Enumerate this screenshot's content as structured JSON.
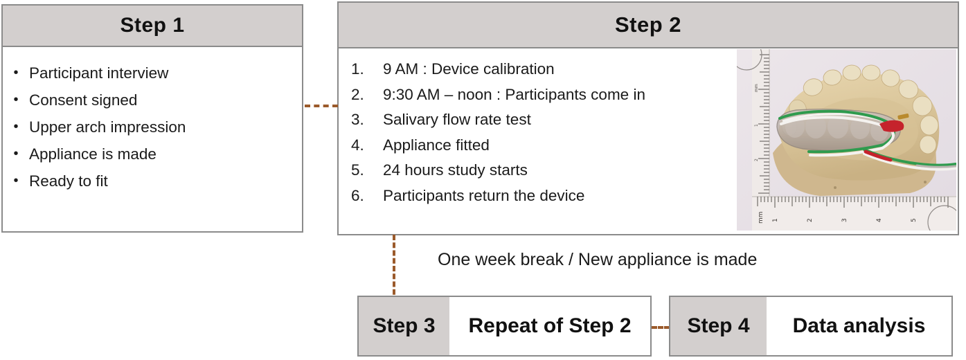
{
  "diagram": {
    "title": "Study protocol flow diagram",
    "colors": {
      "header_gray": "#d3cfce",
      "border_gray": "#8b8b8b",
      "connector_brown": "#9b5a2b",
      "text": "#1a1a1a"
    }
  },
  "step1": {
    "header": "Step 1",
    "bullet_glyph": "•",
    "items": [
      "Participant interview",
      "Consent signed",
      "Upper arch impression",
      "Appliance is made",
      "Ready to fit"
    ]
  },
  "step2": {
    "header": "Step 2",
    "items": [
      {
        "number": "1.",
        "text": "9 AM : Device calibration"
      },
      {
        "number": "2.",
        "text": "9:30 AM – noon : Participants come in"
      },
      {
        "number": "3.",
        "text": "Salivary flow rate test"
      },
      {
        "number": "4.",
        "text": "Appliance fitted"
      },
      {
        "number": "5.",
        "text": "24 hours study starts"
      },
      {
        "number": "6.",
        "text": "Participants return the device"
      }
    ],
    "photo_caption": "Dental stone cast of upper arch with clear intra-oral appliance and wired sensor, shown against a millimetre ruler"
  },
  "break_caption": "One week break / New appliance is made",
  "step3": {
    "label": "Step 3",
    "value": "Repeat of Step 2"
  },
  "step4": {
    "label": "Step 4",
    "value": "Data analysis"
  }
}
